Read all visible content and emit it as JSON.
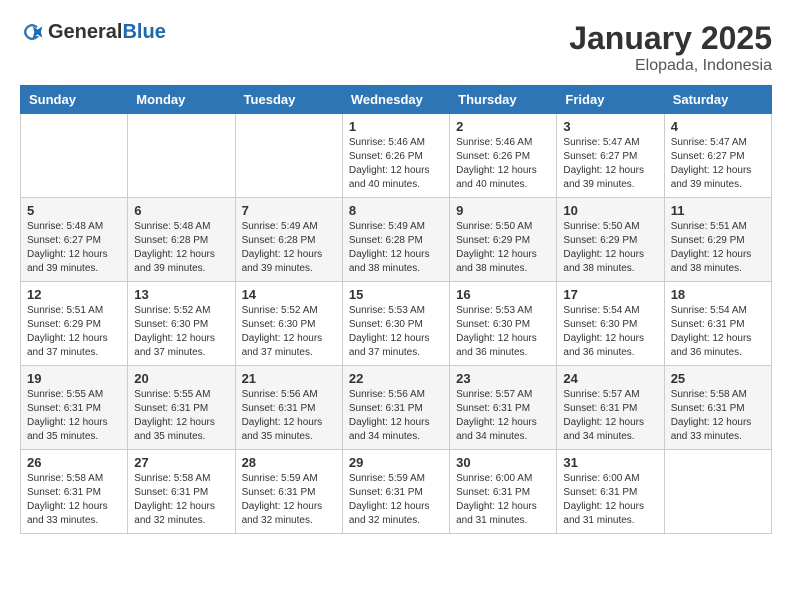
{
  "logo": {
    "general": "General",
    "blue": "Blue"
  },
  "header": {
    "month": "January 2025",
    "location": "Elopada, Indonesia"
  },
  "weekdays": [
    "Sunday",
    "Monday",
    "Tuesday",
    "Wednesday",
    "Thursday",
    "Friday",
    "Saturday"
  ],
  "weeks": [
    [
      {
        "day": "",
        "info": ""
      },
      {
        "day": "",
        "info": ""
      },
      {
        "day": "",
        "info": ""
      },
      {
        "day": "1",
        "info": "Sunrise: 5:46 AM\nSunset: 6:26 PM\nDaylight: 12 hours\nand 40 minutes."
      },
      {
        "day": "2",
        "info": "Sunrise: 5:46 AM\nSunset: 6:26 PM\nDaylight: 12 hours\nand 40 minutes."
      },
      {
        "day": "3",
        "info": "Sunrise: 5:47 AM\nSunset: 6:27 PM\nDaylight: 12 hours\nand 39 minutes."
      },
      {
        "day": "4",
        "info": "Sunrise: 5:47 AM\nSunset: 6:27 PM\nDaylight: 12 hours\nand 39 minutes."
      }
    ],
    [
      {
        "day": "5",
        "info": "Sunrise: 5:48 AM\nSunset: 6:27 PM\nDaylight: 12 hours\nand 39 minutes."
      },
      {
        "day": "6",
        "info": "Sunrise: 5:48 AM\nSunset: 6:28 PM\nDaylight: 12 hours\nand 39 minutes."
      },
      {
        "day": "7",
        "info": "Sunrise: 5:49 AM\nSunset: 6:28 PM\nDaylight: 12 hours\nand 39 minutes."
      },
      {
        "day": "8",
        "info": "Sunrise: 5:49 AM\nSunset: 6:28 PM\nDaylight: 12 hours\nand 38 minutes."
      },
      {
        "day": "9",
        "info": "Sunrise: 5:50 AM\nSunset: 6:29 PM\nDaylight: 12 hours\nand 38 minutes."
      },
      {
        "day": "10",
        "info": "Sunrise: 5:50 AM\nSunset: 6:29 PM\nDaylight: 12 hours\nand 38 minutes."
      },
      {
        "day": "11",
        "info": "Sunrise: 5:51 AM\nSunset: 6:29 PM\nDaylight: 12 hours\nand 38 minutes."
      }
    ],
    [
      {
        "day": "12",
        "info": "Sunrise: 5:51 AM\nSunset: 6:29 PM\nDaylight: 12 hours\nand 37 minutes."
      },
      {
        "day": "13",
        "info": "Sunrise: 5:52 AM\nSunset: 6:30 PM\nDaylight: 12 hours\nand 37 minutes."
      },
      {
        "day": "14",
        "info": "Sunrise: 5:52 AM\nSunset: 6:30 PM\nDaylight: 12 hours\nand 37 minutes."
      },
      {
        "day": "15",
        "info": "Sunrise: 5:53 AM\nSunset: 6:30 PM\nDaylight: 12 hours\nand 37 minutes."
      },
      {
        "day": "16",
        "info": "Sunrise: 5:53 AM\nSunset: 6:30 PM\nDaylight: 12 hours\nand 36 minutes."
      },
      {
        "day": "17",
        "info": "Sunrise: 5:54 AM\nSunset: 6:30 PM\nDaylight: 12 hours\nand 36 minutes."
      },
      {
        "day": "18",
        "info": "Sunrise: 5:54 AM\nSunset: 6:31 PM\nDaylight: 12 hours\nand 36 minutes."
      }
    ],
    [
      {
        "day": "19",
        "info": "Sunrise: 5:55 AM\nSunset: 6:31 PM\nDaylight: 12 hours\nand 35 minutes."
      },
      {
        "day": "20",
        "info": "Sunrise: 5:55 AM\nSunset: 6:31 PM\nDaylight: 12 hours\nand 35 minutes."
      },
      {
        "day": "21",
        "info": "Sunrise: 5:56 AM\nSunset: 6:31 PM\nDaylight: 12 hours\nand 35 minutes."
      },
      {
        "day": "22",
        "info": "Sunrise: 5:56 AM\nSunset: 6:31 PM\nDaylight: 12 hours\nand 34 minutes."
      },
      {
        "day": "23",
        "info": "Sunrise: 5:57 AM\nSunset: 6:31 PM\nDaylight: 12 hours\nand 34 minutes."
      },
      {
        "day": "24",
        "info": "Sunrise: 5:57 AM\nSunset: 6:31 PM\nDaylight: 12 hours\nand 34 minutes."
      },
      {
        "day": "25",
        "info": "Sunrise: 5:58 AM\nSunset: 6:31 PM\nDaylight: 12 hours\nand 33 minutes."
      }
    ],
    [
      {
        "day": "26",
        "info": "Sunrise: 5:58 AM\nSunset: 6:31 PM\nDaylight: 12 hours\nand 33 minutes."
      },
      {
        "day": "27",
        "info": "Sunrise: 5:58 AM\nSunset: 6:31 PM\nDaylight: 12 hours\nand 32 minutes."
      },
      {
        "day": "28",
        "info": "Sunrise: 5:59 AM\nSunset: 6:31 PM\nDaylight: 12 hours\nand 32 minutes."
      },
      {
        "day": "29",
        "info": "Sunrise: 5:59 AM\nSunset: 6:31 PM\nDaylight: 12 hours\nand 32 minutes."
      },
      {
        "day": "30",
        "info": "Sunrise: 6:00 AM\nSunset: 6:31 PM\nDaylight: 12 hours\nand 31 minutes."
      },
      {
        "day": "31",
        "info": "Sunrise: 6:00 AM\nSunset: 6:31 PM\nDaylight: 12 hours\nand 31 minutes."
      },
      {
        "day": "",
        "info": ""
      }
    ]
  ]
}
